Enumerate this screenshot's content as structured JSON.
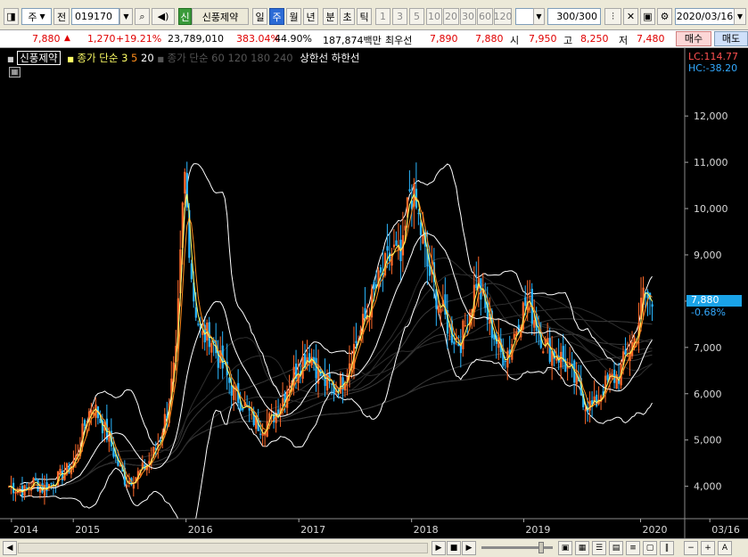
{
  "toolbar": {
    "market": "주",
    "prev_label": "전",
    "code": "019170",
    "stock_badge": "신",
    "stock_name": "신풍제약",
    "periods": [
      "일",
      "주",
      "월",
      "년",
      "분",
      "초",
      "틱"
    ],
    "selected_period": "주",
    "numbers": [
      "1",
      "3",
      "5",
      "10",
      "20",
      "30",
      "60",
      "120"
    ],
    "count": "300",
    "count_total": "/300",
    "date": "2020/03/16"
  },
  "quote": {
    "price": "7,880",
    "change_arrow": "▲",
    "change": "1,270",
    "change_pct": "+19.21%",
    "volume": "23,789,010",
    "vol_ratio": "383.04%",
    "turnover": "44.90%",
    "amount": "187,874백만",
    "best_ask_label": "최우선",
    "best_ask": "7,890",
    "best_bid": "7,880",
    "open_label": "시",
    "open": "7,950",
    "high_label": "고",
    "high": "8,250",
    "low_label": "저",
    "low": "7,480",
    "buy_label": "매수",
    "sell_label": "매도"
  },
  "legend": {
    "name": "신풍제약",
    "ma_label": "종가 단순",
    "ma_periods": [
      "3",
      "5",
      "20"
    ],
    "dim_text": "종가 단순 60  120  180  240",
    "upper_label": "상한선",
    "lower_label": "하한선"
  },
  "scale": {
    "lc": "LC:114.77",
    "hc": "HC:-38.20",
    "current_price": "7,880",
    "current_pct": "-0.68%"
  },
  "colors": {
    "up": "#ff6a2a",
    "down": "#2bb7ff",
    "ma3": "#ffff66",
    "ma5": "#ff8c1a",
    "band": "#ffffff",
    "grid": "#404040"
  },
  "chart_data": {
    "type": "candlestick",
    "x_labels": [
      "2014",
      "2015",
      "2016",
      "2017",
      "2018",
      "2019",
      "2020",
      "03/16"
    ],
    "y_ticks": [
      4000,
      5000,
      6000,
      7000,
      8000,
      9000,
      10000,
      11000,
      12000
    ],
    "y_tick_labels": [
      "4,000",
      "5,000",
      "6,000",
      "7,000",
      "8,000",
      "9,000",
      "10,000",
      "11,000",
      "12,000"
    ],
    "ylim": [
      3300,
      12600
    ],
    "close_series": [
      4000,
      3950,
      3900,
      4100,
      3950,
      4050,
      4200,
      4350,
      4600,
      5300,
      5800,
      5400,
      5000,
      4500,
      4100,
      4200,
      4350,
      4600,
      5000,
      5700,
      6800,
      10800,
      8200,
      7200,
      7300,
      6800,
      6400,
      6000,
      5800,
      5500,
      5300,
      5400,
      5600,
      6000,
      6400,
      6700,
      6900,
      6500,
      6200,
      6100,
      6300,
      6900,
      7300,
      7800,
      8300,
      8700,
      9100,
      8800,
      10500,
      9800,
      8800,
      8200,
      7700,
      7300,
      7100,
      7700,
      8500,
      7800,
      7300,
      6800,
      7000,
      7600,
      8000,
      7600,
      7100,
      6900,
      6800,
      6500,
      6200,
      5800,
      5700,
      6100,
      6300,
      6400,
      6900,
      7200,
      8200,
      7880
    ]
  },
  "bottom": {
    "buttons": [
      "◀",
      "▶",
      "■",
      "▶",
      "−",
      "+",
      "A"
    ]
  }
}
